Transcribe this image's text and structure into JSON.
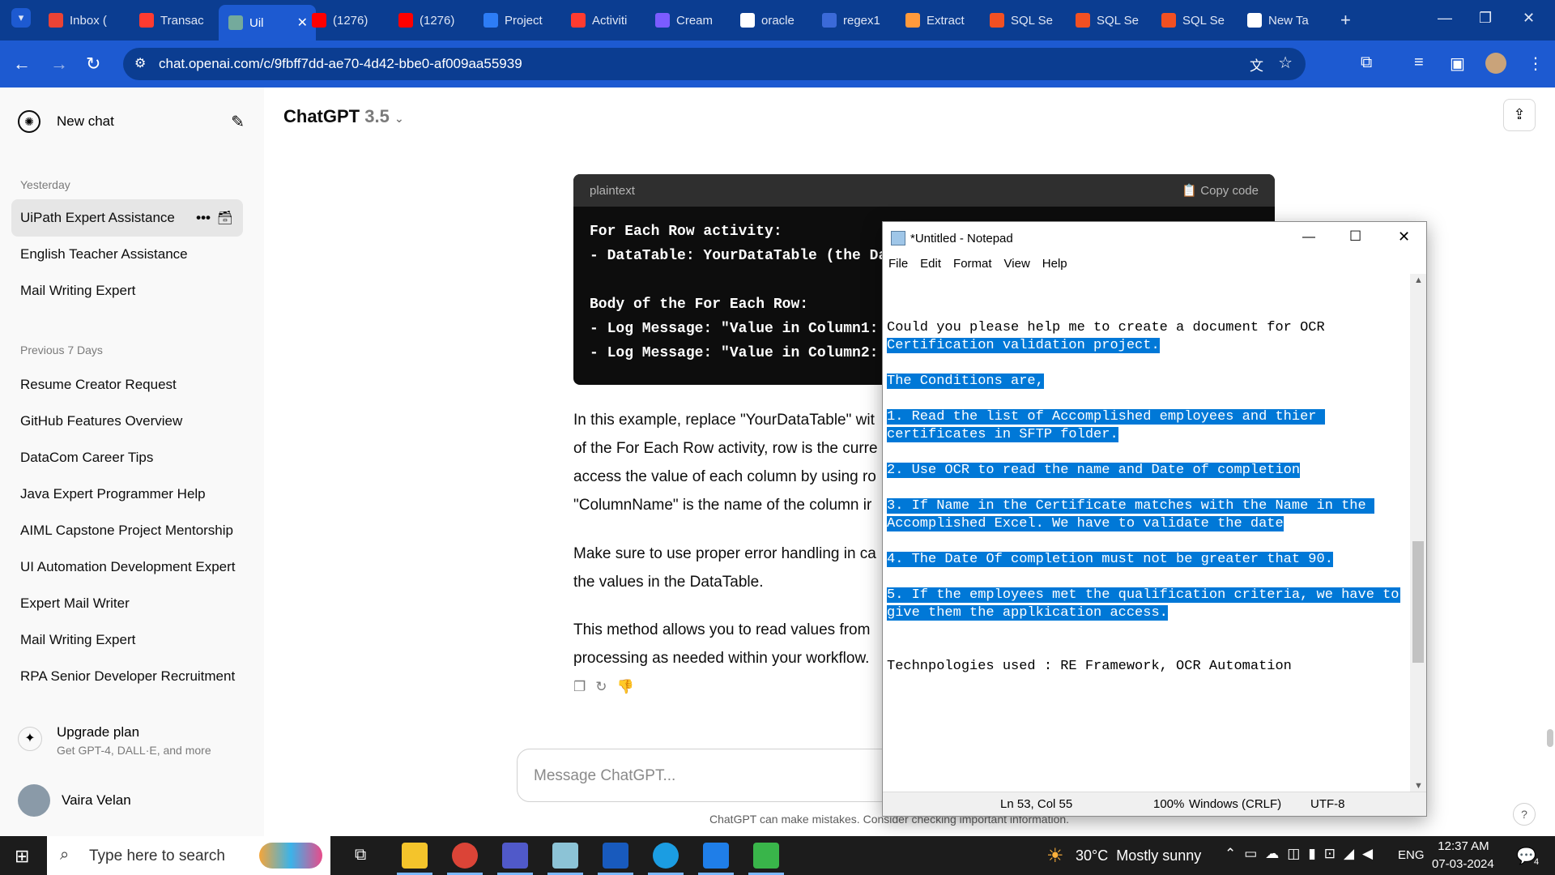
{
  "browser": {
    "tabs": [
      {
        "label": "Inbox (",
        "color": "#ea4335"
      },
      {
        "label": "Transac",
        "color": "#ff3b30"
      },
      {
        "label": "Uil",
        "color": "#74aa9c",
        "active": true
      },
      {
        "label": "(1276)",
        "color": "#ff0000"
      },
      {
        "label": "(1276)",
        "color": "#ff0000"
      },
      {
        "label": "Project",
        "color": "#2d7df6"
      },
      {
        "label": "Activiti",
        "color": "#ff3b30"
      },
      {
        "label": "Cream",
        "color": "#7b5cff"
      },
      {
        "label": "oracle",
        "color": "#ffffff"
      },
      {
        "label": "regex1",
        "color": "#3b6ad8"
      },
      {
        "label": "Extract",
        "color": "#ff9a3c"
      },
      {
        "label": "SQL Se",
        "color": "#f25022"
      },
      {
        "label": "SQL Se",
        "color": "#f25022"
      },
      {
        "label": "SQL Se",
        "color": "#f25022"
      },
      {
        "label": "New Ta",
        "color": "#ffffff"
      }
    ],
    "url": "chat.openai.com/c/9fbff7dd-ae70-4d42-bbe0-af009aa55939"
  },
  "sidebar": {
    "new_chat": "New chat",
    "yesterday_label": "Yesterday",
    "yesterday": [
      "UiPath Expert Assistance",
      "English Teacher Assistance",
      "Mail Writing Expert"
    ],
    "prev7_label": "Previous 7 Days",
    "prev7": [
      "Resume Creator Request",
      "GitHub Features Overview",
      "DataCom Career Tips",
      "Java Expert Programmer Help",
      "AIML Capstone Project Mentorship",
      "UI Automation Development Expert",
      "Expert Mail Writer",
      "Mail Writing Expert",
      "RPA Senior Developer Recruitment"
    ],
    "upgrade_title": "Upgrade plan",
    "upgrade_sub": "Get GPT-4, DALL·E, and more",
    "user_name": "Vaira Velan"
  },
  "main": {
    "model_name": "ChatGPT",
    "model_version": "3.5",
    "code_lang": "plaintext",
    "copy_label": "Copy code",
    "code_lines": [
      "For Each Row activity:",
      "- DataTable: YourDataTable (the Dat",
      "",
      "Body of the For Each Row:",
      "- Log Message: \"Value in Column1: '",
      "- Log Message: \"Value in Column2: '"
    ],
    "para1": [
      "In this example, replace \"YourDataTable\" wit",
      "of the For Each Row activity, row is the curre",
      "access the value of each column by using ro",
      "\"ColumnName\" is the name of the column ir"
    ],
    "para2": [
      "Make sure to use proper error handling in ca",
      "the values in the DataTable."
    ],
    "para3": [
      "This method allows you to read values from",
      "processing as needed within your workflow."
    ],
    "message_placeholder": "Message ChatGPT...",
    "disclaimer": "ChatGPT can make mistakes. Consider checking important information."
  },
  "notepad": {
    "title": "*Untitled - Notepad",
    "menu": [
      "File",
      "Edit",
      "Format",
      "View",
      "Help"
    ],
    "lines": [
      {
        "text": "",
        "sel": false
      },
      {
        "text": "",
        "sel": false
      },
      {
        "text": "Could you please help me to create a document for OCR",
        "sel": false
      },
      {
        "text": "Certification validation project.",
        "sel": true
      },
      {
        "text": "",
        "sel": false
      },
      {
        "text": "The Conditions are,",
        "sel": true
      },
      {
        "text": "",
        "sel": false
      },
      {
        "text": "1. Read the list of Accomplished employees and thier ",
        "sel": true
      },
      {
        "text": "certificates in SFTP folder.",
        "sel": true
      },
      {
        "text": "",
        "sel": false
      },
      {
        "text": "2. Use OCR to read the name and Date of completion",
        "sel": true
      },
      {
        "text": "",
        "sel": false
      },
      {
        "text": "3. If Name in the Certificate matches with the Name in the ",
        "sel": true
      },
      {
        "text": "Accomplished Excel. We have to validate the date",
        "sel": true
      },
      {
        "text": "",
        "sel": false
      },
      {
        "text": "4. The Date Of completion must not be greater that 90.",
        "sel": true
      },
      {
        "text": "",
        "sel": false
      },
      {
        "text": "5. If the employees met the qualification criteria, we have to ",
        "sel": true
      },
      {
        "text": "give them the applkication access.",
        "sel": true
      },
      {
        "text": "",
        "sel": false
      },
      {
        "text": "",
        "sel": false
      },
      {
        "text": "Technpologies used : RE Framework, OCR Automation",
        "sel": false
      }
    ],
    "status_pos": "Ln 53, Col 55",
    "status_zoom": "100%",
    "status_eol": "Windows (CRLF)",
    "status_enc": "UTF-8"
  },
  "taskbar": {
    "search_placeholder": "Type here to search",
    "weather": "30°C  Mostly sunny",
    "lang": "ENG",
    "time": "12:37 AM",
    "date": "07-03-2024",
    "notif_count": "4"
  }
}
